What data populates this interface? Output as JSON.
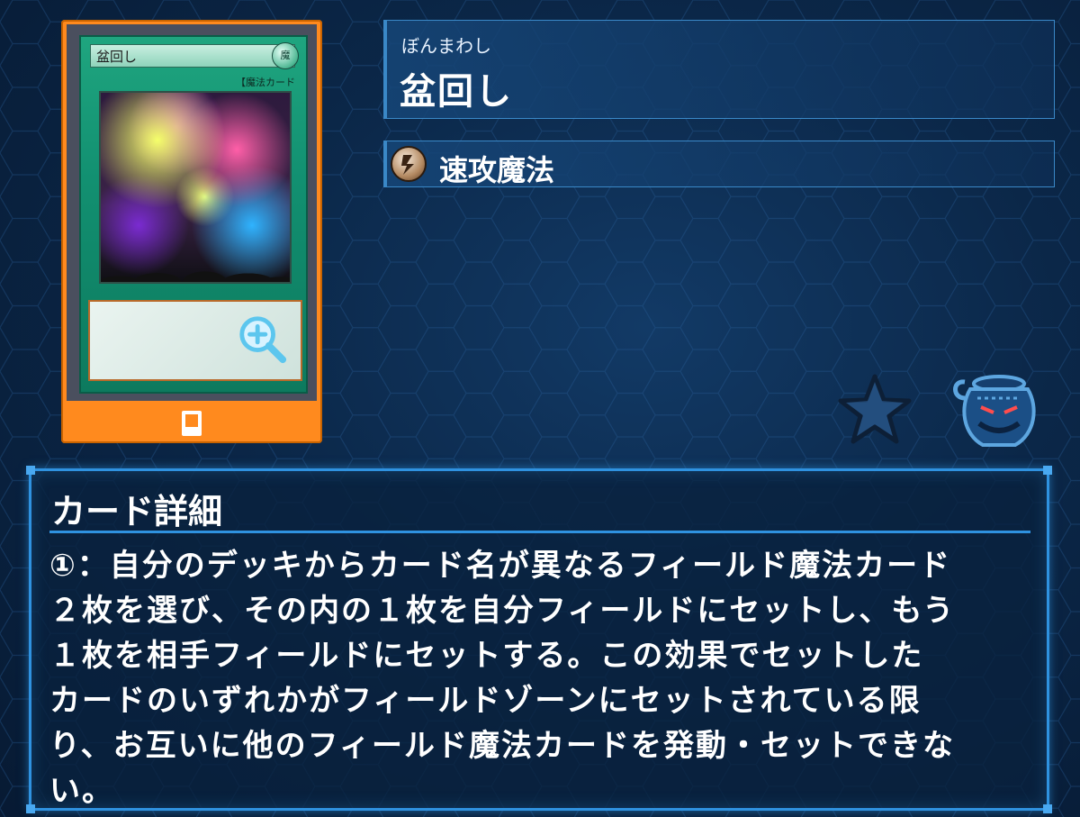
{
  "card": {
    "ruby": "ぼんまわし",
    "name": "盆回し",
    "type_label": "速攻魔法",
    "art_name": "盆回し",
    "art_type_line": "【魔法カード",
    "art_attribute": "魔"
  },
  "details": {
    "title": "カード詳細",
    "text": "①：自分のデッキからカード名が異なるフィールド魔法カード\n２枚を選び、その内の１枚を自分フィールドにセットし、もう\n１枚を相手フィールドにセットする。この効果でセットした\nカードのいずれかがフィールドゾーンにセットされている限\nり、お互いに他のフィールド魔法カードを発動・セットできな\nい。"
  },
  "icons": {
    "zoom": "zoom-in-icon",
    "card": "card-icon",
    "type": "quick-play-spell-icon",
    "star": "star-icon",
    "pot": "pot-of-greed-icon"
  },
  "colors": {
    "accent_orange": "#ff8a1e",
    "panel_border": "#2f92e0",
    "spell_green": "#129071"
  }
}
